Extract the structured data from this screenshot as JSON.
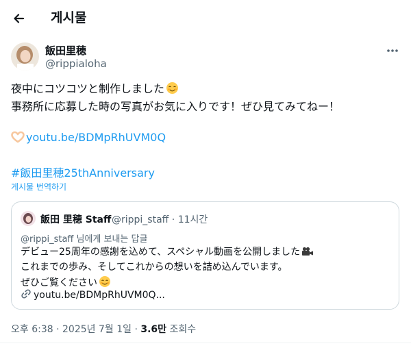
{
  "header": {
    "title": "게시물"
  },
  "author": {
    "name": "飯田里穂",
    "handle": "@rippialoha"
  },
  "post": {
    "line1": "夜中にコツコツと制作しました",
    "line2": "事務所に応募した時の写真がお気に入りです！ぜひ見てみてねー！",
    "link": "youtu.be/BDMpRhUVM0Q",
    "hashtag": "#飯田里穂25thAnniversary",
    "translate": "게시물 번역하기"
  },
  "quote": {
    "name": "飯田 里穂 Staff",
    "handle": "@rippi_staff",
    "time": "11시간",
    "reply_to": "@rippi_staff 님에게 보내는 답글",
    "line1": "デビュー25周年の感謝を込めて、スペシャル動画を公開しました",
    "line2": "これまでの歩み、そしてこれからの想いを詰め込んでいます。",
    "line3": "ぜひご覧ください",
    "link": "youtu.be/BDMpRhUVM0Q..."
  },
  "footer": {
    "time": "오후 6:38",
    "date": "2025년 7월 1일",
    "views": "3.6만",
    "views_label": "조회수"
  },
  "colors": {
    "accent": "#1d9bf0",
    "muted": "#536471",
    "border": "#cfd9de"
  },
  "icons": [
    "back-arrow-icon",
    "more-icon",
    "blush-smile-emoji-icon",
    "heart-hands-emoji-icon",
    "movie-camera-emoji-icon",
    "smiling-emoji-icon",
    "link-icon"
  ]
}
